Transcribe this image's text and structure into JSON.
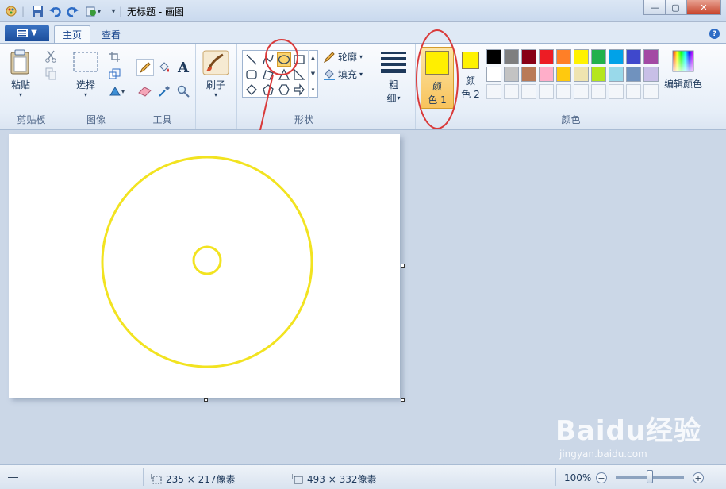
{
  "window": {
    "title": "无标题 - 画图",
    "minimize": "—",
    "maximize": "▢",
    "close": "✕"
  },
  "tabs": [
    {
      "label": "主页",
      "active": true
    },
    {
      "label": "查看",
      "active": false
    }
  ],
  "help": "?",
  "groups": {
    "clipboard": {
      "label": "剪贴板",
      "paste": "粘贴"
    },
    "image": {
      "label": "图像",
      "select": "选择"
    },
    "tools": {
      "label": "工具",
      "text_tool": "A"
    },
    "brushes": {
      "label": "刷子"
    },
    "shapes": {
      "label": "形状",
      "outline": "轮廓",
      "fill": "填充",
      "selected": "ellipse"
    },
    "size": {
      "label_line1": "粗",
      "label_line2": "细"
    },
    "colors": {
      "label": "颜色",
      "color1_line1": "颜",
      "color1_line2": "色 1",
      "color2_line1": "颜",
      "color2_line2": "色 2",
      "color1": "#ffef00",
      "color2": "#fff200",
      "edit_colors": "编辑颜色",
      "palette_row1": [
        "#000000",
        "#7f7f7f",
        "#880015",
        "#ed1c24",
        "#ff7f27",
        "#fff200",
        "#22b14c",
        "#00a2e8",
        "#3f48cc",
        "#a349a4"
      ],
      "palette_row2": [
        "#ffffff",
        "#c3c3c3",
        "#b97a57",
        "#ffaec9",
        "#ffc90e",
        "#efe4b0",
        "#b5e61d",
        "#99d9ea",
        "#7092be",
        "#c8bfe7"
      ]
    }
  },
  "canvas": {
    "outline_color": "#f2e320"
  },
  "status": {
    "selection_size": "235 × 217像素",
    "canvas_size": "493 × 332像素",
    "zoom": "100%",
    "zoom_level": 0.5
  },
  "watermark": {
    "brand": "Baidu经验",
    "url": "jingyan.baidu.com"
  }
}
